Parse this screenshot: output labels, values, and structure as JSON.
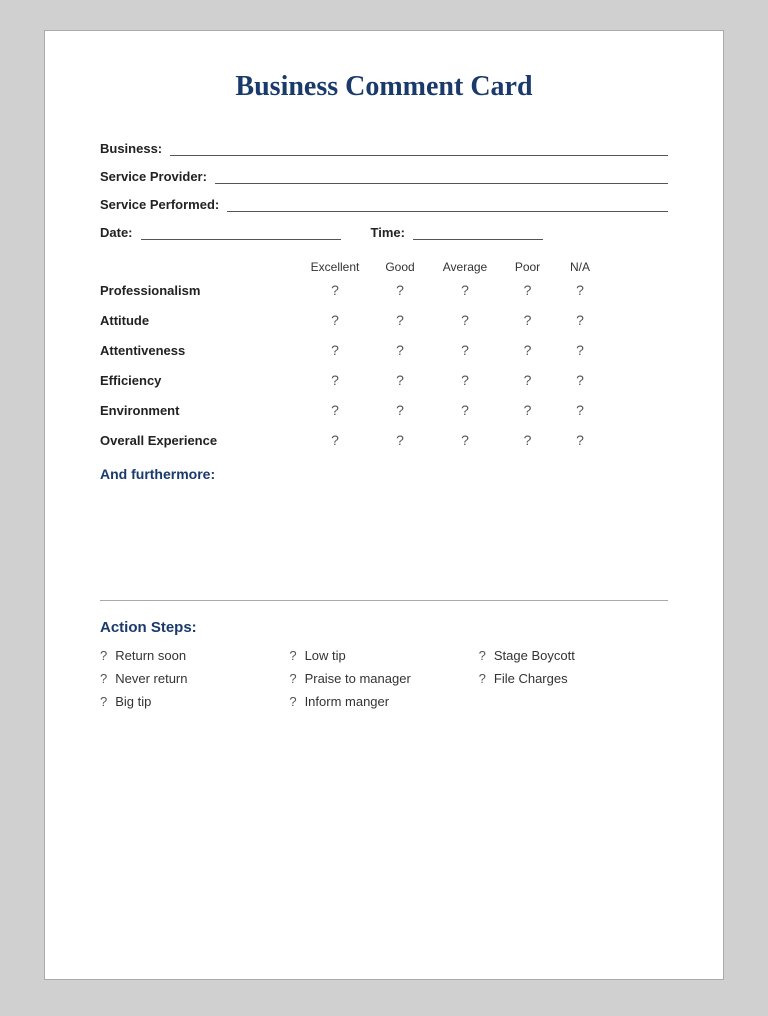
{
  "card": {
    "title": "Business Comment Card",
    "fields": [
      {
        "label": "Business:",
        "id": "business"
      },
      {
        "label": "Service Provider:",
        "id": "service-provider"
      },
      {
        "label": "Service Performed:",
        "id": "service-performed"
      }
    ],
    "date_label": "Date:",
    "time_label": "Time:",
    "rating_headers": [
      "",
      "Excellent",
      "Good",
      "Average",
      "Poor",
      "N/A"
    ],
    "rating_rows": [
      {
        "label": "Professionalism"
      },
      {
        "label": "Attitude"
      },
      {
        "label": "Attentiveness"
      },
      {
        "label": "Efficiency"
      },
      {
        "label": "Environment"
      },
      {
        "label": "Overall Experience"
      }
    ],
    "rating_symbol": "?",
    "furthermore_label": "And furthermore:",
    "divider": true,
    "action_steps_label": "Action Steps:",
    "action_items_col1": [
      {
        "symbol": "?",
        "label": "Return soon"
      },
      {
        "symbol": "?",
        "label": "Never return"
      },
      {
        "symbol": "?",
        "label": "Big tip"
      }
    ],
    "action_items_col2": [
      {
        "symbol": "?",
        "label": "Low tip"
      },
      {
        "symbol": "?",
        "label": "Praise to manager"
      },
      {
        "symbol": "?",
        "label": "Inform manger"
      }
    ],
    "action_items_col3": [
      {
        "symbol": "?",
        "label": "Stage Boycott"
      },
      {
        "symbol": "?",
        "label": "File Charges"
      }
    ]
  }
}
